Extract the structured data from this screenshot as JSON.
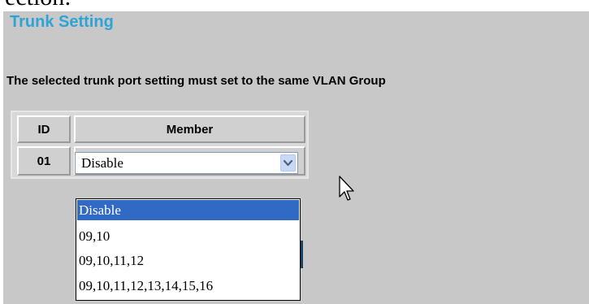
{
  "top_fragment": "ection:",
  "page": {
    "title": "Trunk Setting",
    "note": "The selected trunk port setting must set to the same VLAN Group"
  },
  "table": {
    "headers": {
      "id": "ID",
      "member": "Member"
    },
    "rows": [
      {
        "id": "01",
        "member": "Disable"
      }
    ]
  },
  "dropdown": {
    "options": [
      "Disable",
      "09,10",
      "09,10,11,12",
      "09,10,11,12,13,14,15,16"
    ],
    "selected": "Disable"
  },
  "colors": {
    "title": "#2ea3d6",
    "background": "#c8c8c8",
    "selection": "#316ac5"
  },
  "icons": {
    "dropdown_arrow": "chevron-down-icon",
    "cursor": "mouse-cursor-icon"
  }
}
